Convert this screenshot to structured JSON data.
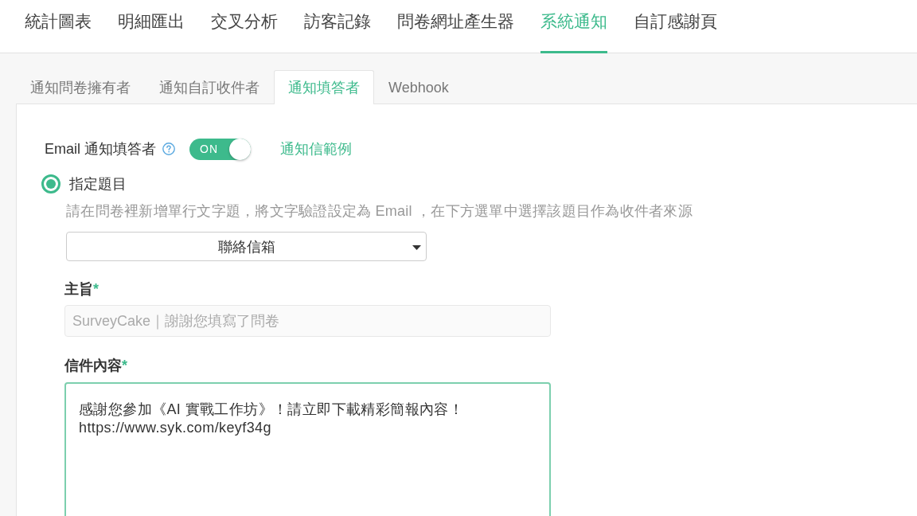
{
  "top_tabs": [
    {
      "label": "統計圖表",
      "selected": false
    },
    {
      "label": "明細匯出",
      "selected": false
    },
    {
      "label": "交叉分析",
      "selected": false
    },
    {
      "label": "訪客記錄",
      "selected": false
    },
    {
      "label": "問卷網址產生器",
      "selected": false
    },
    {
      "label": "系統通知",
      "selected": true
    },
    {
      "label": "自訂感謝頁",
      "selected": false
    }
  ],
  "sub_tabs": [
    {
      "label": "通知問卷擁有者",
      "selected": false
    },
    {
      "label": "通知自訂收件者",
      "selected": false
    },
    {
      "label": "通知填答者",
      "selected": true
    },
    {
      "label": "Webhook",
      "selected": false
    }
  ],
  "email_notify": {
    "label": "Email 通知填答者",
    "toggle": {
      "label": "ON",
      "on": true
    },
    "example_link": "通知信範例"
  },
  "recipient_option": {
    "label": "指定題目",
    "selected": true,
    "hint": "請在問卷裡新增單行文字題，將文字驗證設定為 Email ，在下方選單中選擇該題目作為收件者來源",
    "select_value": "聯絡信箱"
  },
  "subject": {
    "label": "主旨",
    "required_mark": "*",
    "placeholder": "SurveyCake｜謝謝您填寫了問卷"
  },
  "body": {
    "label": "信件內容",
    "required_mark": "*",
    "value": "感謝您參加《AI 實戰工作坊》！請立即下載精彩簡報內容！\nhttps://www.syk.com/keyf34g",
    "focused": true
  }
}
